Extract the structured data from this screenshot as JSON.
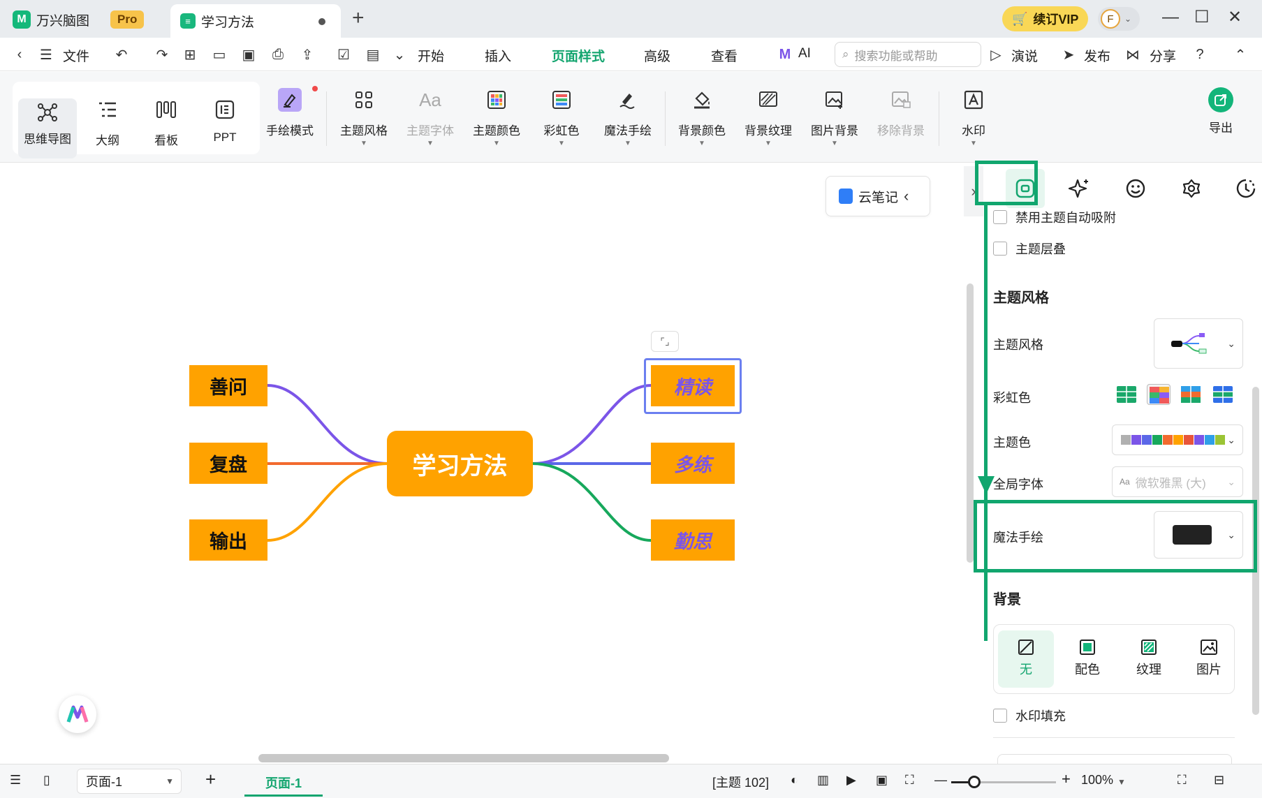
{
  "titlebar": {
    "app_name": "万兴脑图",
    "pro_badge": "Pro",
    "doc_tab": "学习方法",
    "new_tab": "+",
    "vip": "续订VIP",
    "avatar_letter": "F"
  },
  "menubar": {
    "file": "文件",
    "tabs": [
      "开始",
      "插入",
      "页面样式",
      "高级",
      "查看"
    ],
    "active_tab": "页面样式",
    "ai": "AI",
    "search_placeholder": "搜索功能或帮助",
    "present": "演说",
    "publish": "发布",
    "share": "分享"
  },
  "ribbon": {
    "views": [
      "思维导图",
      "大纲",
      "看板",
      "PPT"
    ],
    "selected_view": "思维导图",
    "tools": [
      {
        "label": "手绘模式",
        "enabled": true
      },
      {
        "label": "主题风格",
        "enabled": true
      },
      {
        "label": "主题字体",
        "enabled": false
      },
      {
        "label": "主题颜色",
        "enabled": true
      },
      {
        "label": "彩虹色",
        "enabled": true
      },
      {
        "label": "魔法手绘",
        "enabled": true
      },
      {
        "label": "背景颜色",
        "enabled": true
      },
      {
        "label": "背景纹理",
        "enabled": true
      },
      {
        "label": "图片背景",
        "enabled": true
      },
      {
        "label": "移除背景",
        "enabled": false
      },
      {
        "label": "水印",
        "enabled": true
      }
    ],
    "export": "导出"
  },
  "canvas": {
    "central": "学习方法",
    "left_nodes": [
      "善问",
      "复盘",
      "输出"
    ],
    "right_nodes": [
      "精读",
      "多练",
      "勤思"
    ],
    "selected_node": "精读",
    "cloud_note": "云笔记",
    "branch_colors": {
      "left": [
        "#7b55e8",
        "#f26a2e",
        "#ffa200"
      ],
      "right": [
        "#7b55e8",
        "#5b67e8",
        "#17a85c"
      ]
    },
    "node_color": "#ffa200"
  },
  "panel": {
    "checkboxes": [
      "禁用主题自动吸附",
      "主题层叠"
    ],
    "theme_section": "主题风格",
    "theme_style_label": "主题风格",
    "rainbow_label": "彩虹色",
    "theme_color_label": "主题色",
    "font_label": "全局字体",
    "font_value": "微软雅黑 (大)",
    "magic_label": "魔法手绘",
    "background_section": "背景",
    "bg_options": [
      "无",
      "配色",
      "纹理",
      "图片"
    ],
    "active_bg": "无",
    "watermark_fill": "水印填充",
    "theme_swatches": [
      "#b0b0b0",
      "#7b55e8",
      "#5b67e8",
      "#17a85c",
      "#f26a2e",
      "#ffa200",
      "#e8553a",
      "#7b55e8",
      "#2f9fe8",
      "#9bc435"
    ]
  },
  "statusbar": {
    "page_select": "页面-1",
    "page_tab": "页面-1",
    "topic_count": "[主题 102]",
    "zoom": "100%",
    "zoom_fraction": 0.22
  },
  "annotation_color": "#11a66e"
}
